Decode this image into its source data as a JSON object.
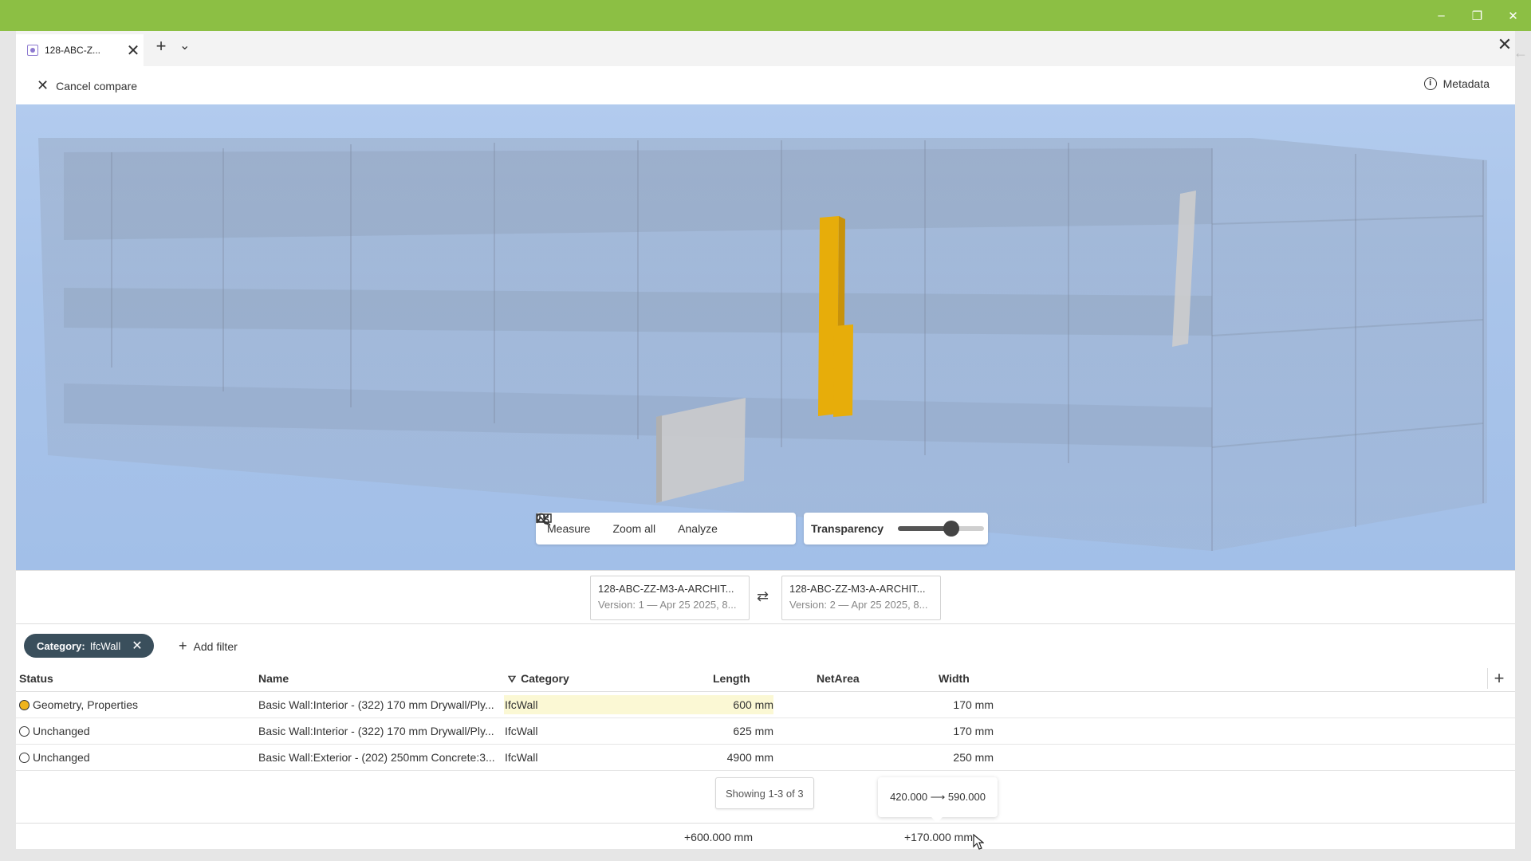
{
  "window": {
    "controls": [
      "–",
      "❐",
      "✕"
    ]
  },
  "tab": {
    "title": "128-ABC-Z...",
    "close": "✕",
    "new": "+",
    "dropdown": "⌄",
    "bar_close": "✕"
  },
  "header": {
    "cancel_label": "Cancel compare",
    "metadata_label": "Metadata"
  },
  "toolbar": {
    "measure_label": "Measure",
    "zoom_label": "Zoom all",
    "analyze_label": "Analyze",
    "transparency_label": "Transparency",
    "transparency_value": 0.62
  },
  "versions": {
    "left": {
      "name": "128-ABC-ZZ-M3-A-ARCHIT...",
      "info": "Version: 1 — Apr 25 2025, 8..."
    },
    "right": {
      "name": "128-ABC-ZZ-M3-A-ARCHIT...",
      "info": "Version: 2 — Apr 25 2025, 8..."
    }
  },
  "filter": {
    "key": "Category:",
    "value": "IfcWall",
    "add_label": "Add filter"
  },
  "table": {
    "columns": [
      "Status",
      "Name",
      "Category",
      "Length",
      "NetArea",
      "Width"
    ],
    "rows": [
      {
        "status": "Geometry, Properties",
        "name": "Basic Wall:Interior - (322) 170 mm Drywall/Ply...",
        "category": "IfcWall",
        "length": "600 mm",
        "netarea": "",
        "width": "170 mm"
      },
      {
        "status": "Unchanged",
        "name": "Basic Wall:Interior - (322) 170 mm Drywall/Ply...",
        "category": "IfcWall",
        "length": "625 mm",
        "netarea": "",
        "width": "170 mm"
      },
      {
        "status": "Unchanged",
        "name": "Basic Wall:Exterior - (202) 250mm Concrete:3...",
        "category": "IfcWall",
        "length": "4900 mm",
        "netarea": "",
        "width": "250 mm"
      }
    ]
  },
  "footer": {
    "showing": "Showing 1-3 of 3",
    "tooltip": "420.000 ⟶ 590.000",
    "total_length": "+600.000 mm",
    "total_width": "+170.000 mm"
  },
  "colors": {
    "accent": "#8cbf44",
    "changed": "#f0b41c",
    "highlight": "#fbf8d4",
    "chip": "#3a4f5c"
  }
}
